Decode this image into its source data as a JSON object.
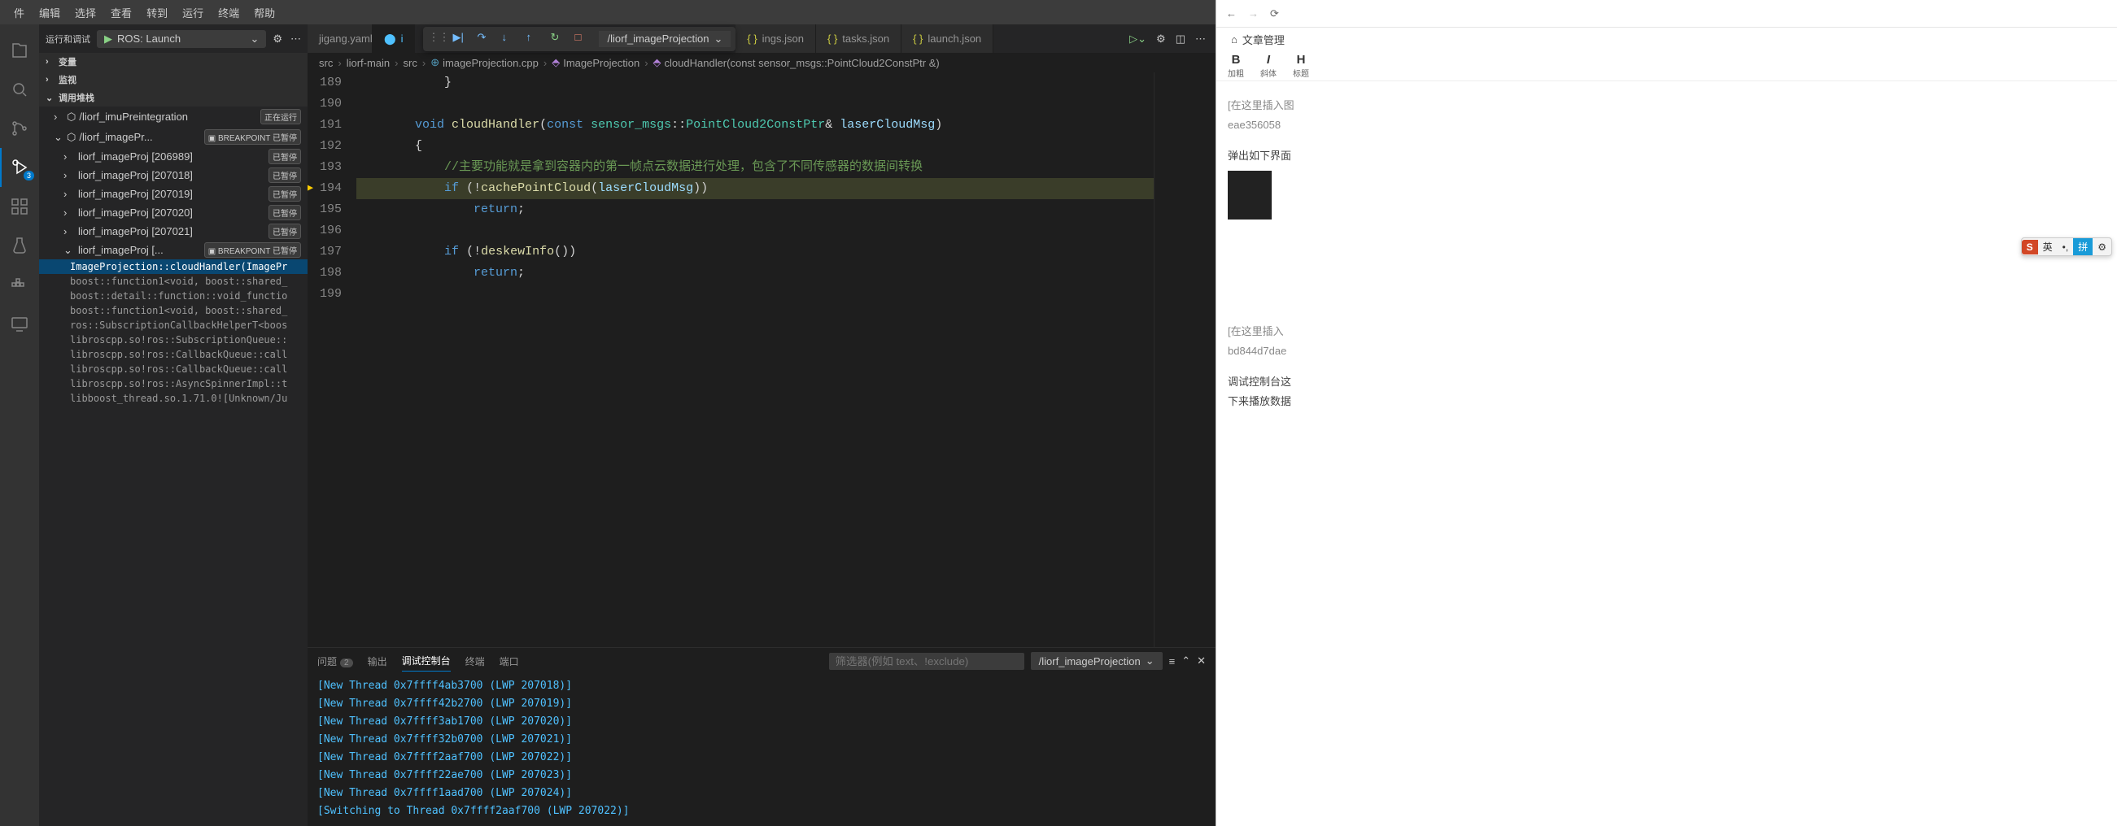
{
  "menubar": [
    "件",
    "编辑",
    "选择",
    "查看",
    "转到",
    "运行",
    "终端",
    "帮助"
  ],
  "sidebar": {
    "title": "运行和调试",
    "config": "ROS: Launch",
    "sections": {
      "vars": "变量",
      "watch": "监视",
      "callstack": "调用堆栈"
    },
    "processes": [
      {
        "name": "/liorf_imuPreintegration",
        "badge": "正在运行"
      },
      {
        "name": "/liorf_imagePr...",
        "badge": "BREAKPOINT 已暂停"
      }
    ],
    "threads": [
      {
        "name": "liorf_imageProj [206989]",
        "badge": "已暂停"
      },
      {
        "name": "liorf_imageProj [207018]",
        "badge": "已暂停"
      },
      {
        "name": "liorf_imageProj [207019]",
        "badge": "已暂停"
      },
      {
        "name": "liorf_imageProj [207020]",
        "badge": "已暂停"
      },
      {
        "name": "liorf_imageProj [207021]",
        "badge": "已暂停"
      },
      {
        "name": "liorf_imageProj [...",
        "badge": "BREAKPOINT 已暂停"
      }
    ],
    "frames": [
      "ImageProjection::cloudHandler(ImagePr",
      "boost::function1<void, boost::shared_",
      "boost::detail::function::void_functio",
      "boost::function1<void, boost::shared_",
      "ros::SubscriptionCallbackHelperT<boos",
      "libroscpp.so!ros::SubscriptionQueue::",
      "libroscpp.so!ros::CallbackQueue::call",
      "libroscpp.so!ros::CallbackQueue::call",
      "libroscpp.so!ros::AsyncSpinnerImpl::t",
      "libboost_thread.so.1.71.0![Unknown/Ju"
    ]
  },
  "tabs": {
    "partial1": "jigang.yaml",
    "partial2": "i",
    "settings": "ings.json",
    "tasks": "tasks.json",
    "launch": "launch.json"
  },
  "debugbar": {
    "config": "/liorf_imageProjection"
  },
  "breadcrumb": {
    "p1": "src",
    "p2": "liorf-main",
    "p3": "src",
    "p4": "imageProjection.cpp",
    "p5": "ImageProjection",
    "p6": "cloudHandler(const sensor_msgs::PointCloud2ConstPtr &)"
  },
  "code": {
    "start": 189,
    "lines": [
      {
        "n": "189",
        "html": "            <span class='par'>}</span>"
      },
      {
        "n": "190",
        "html": ""
      },
      {
        "n": "191",
        "html": "        <span class='kw'>void</span> <span class='fn'>cloudHandler</span><span class='par'>(</span><span class='kw'>const</span> <span class='typ'>sensor_msgs</span><span class='par'>::</span><span class='typ'>PointCloud2ConstPtr</span><span class='par'>&amp;</span> <span class='var'>laserCloudMsg</span><span class='par'>)</span>"
      },
      {
        "n": "192",
        "html": "        <span class='par'>{</span>"
      },
      {
        "n": "193",
        "html": "            <span class='cmt'>//主要功能就是拿到容器内的第一帧点云数据进行处理，包含了不同传感器的数据间转换</span>"
      },
      {
        "n": "194",
        "html": "            <span class='kw'>if</span> <span class='par'>(!</span><span class='fn'>cachePointCloud</span><span class='par'>(</span><span class='var'>laserCloudMsg</span><span class='par'>))</span>",
        "hl": true,
        "cur": true
      },
      {
        "n": "195",
        "html": "                <span class='kw'>return</span><span class='par'>;</span>"
      },
      {
        "n": "196",
        "html": ""
      },
      {
        "n": "197",
        "html": "            <span class='kw'>if</span> <span class='par'>(!</span><span class='fn'>deskewInfo</span><span class='par'>())</span>"
      },
      {
        "n": "198",
        "html": "                <span class='kw'>return</span><span class='par'>;</span>"
      },
      {
        "n": "199",
        "html": ""
      }
    ]
  },
  "panel": {
    "tabs": {
      "problems": "问题",
      "pcount": "2",
      "output": "输出",
      "debug": "调试控制台",
      "terminal": "终端",
      "ports": "端口"
    },
    "filter_ph": "筛选器(例如 text、!exclude)",
    "session": "/liorf_imageProjection",
    "console": [
      "[New Thread 0x7ffff4ab3700 (LWP 207018)]",
      "[New Thread 0x7ffff42b2700 (LWP 207019)]",
      "[New Thread 0x7ffff3ab1700 (LWP 207020)]",
      "[New Thread 0x7ffff32b0700 (LWP 207021)]",
      "[New Thread 0x7ffff2aaf700 (LWP 207022)]",
      "[New Thread 0x7ffff22ae700 (LWP 207023)]",
      "[New Thread 0x7ffff1aad700 (LWP 207024)]",
      "[Switching to Thread 0x7ffff2aaf700 (LWP 207022)]"
    ]
  },
  "right": {
    "crumb": "文章管理",
    "bold": "B",
    "bold_lbl": "加粗",
    "italic": "I",
    "italic_lbl": "斜体",
    "heading": "H",
    "heading_lbl": "标题",
    "body": {
      "l1": "[在这里插入图",
      "l2": "eae356058",
      "l3": "弹出如下界面",
      "l4": "[在这里插入",
      "l5": "bd844d7dae",
      "l6": "调试控制台这",
      "l7": "下来播放数据"
    }
  },
  "ime": {
    "s": "S",
    "lang": "英",
    "mode": "拼"
  },
  "badge3": "3"
}
